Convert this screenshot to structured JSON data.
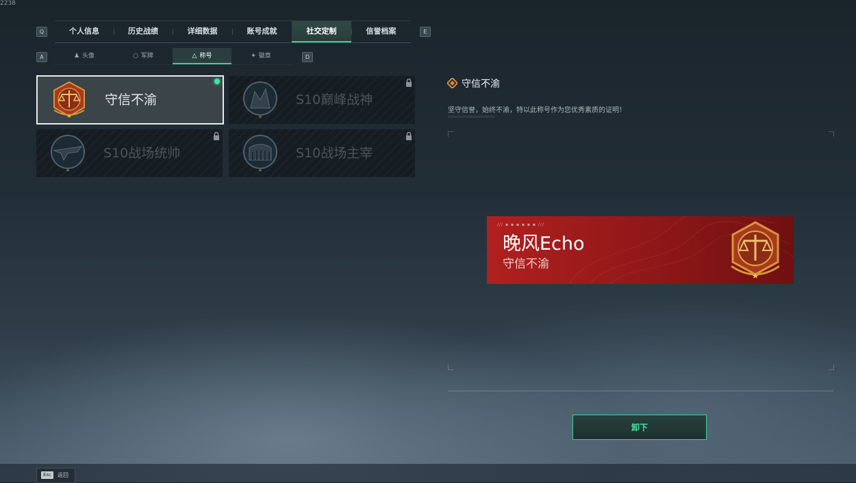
{
  "build_no": "2238",
  "top_nav": {
    "left_key": "Q",
    "right_key": "E",
    "tabs": [
      {
        "label": "个人信息",
        "active": false
      },
      {
        "label": "历史战绩",
        "active": false
      },
      {
        "label": "详细数据",
        "active": false
      },
      {
        "label": "账号成就",
        "active": false
      },
      {
        "label": "社交定制",
        "active": true
      },
      {
        "label": "信誉档案",
        "active": false
      }
    ]
  },
  "sub_nav": {
    "left_key": "A",
    "right_key": "D",
    "tabs": [
      {
        "label": "头像",
        "icon": "person-icon",
        "active": false
      },
      {
        "label": "军牌",
        "icon": "badge-icon",
        "active": false
      },
      {
        "label": "称号",
        "icon": "triangle-icon",
        "active": true
      },
      {
        "label": "徽章",
        "icon": "emblem-icon",
        "active": false
      }
    ]
  },
  "titles": [
    {
      "name": "守信不渝",
      "emblem": "scales-emblem-icon",
      "selected": true,
      "equipped": true,
      "locked": false
    },
    {
      "name": "S10巅峰战神",
      "emblem": "peak-emblem-icon",
      "selected": false,
      "equipped": false,
      "locked": true
    },
    {
      "name": "S10战场统帅",
      "emblem": "aircraft-emblem-icon",
      "selected": false,
      "equipped": false,
      "locked": true
    },
    {
      "name": "S10战场主宰",
      "emblem": "colosseum-emblem-icon",
      "selected": false,
      "equipped": false,
      "locked": true
    }
  ],
  "detail": {
    "icon": "diamond-icon",
    "title": "守信不渝",
    "description": "坚守信誉，始终不渝，特以此称号作为您优秀素质的证明！"
  },
  "nameplate": {
    "player_name": "晚风Echo",
    "title": "守信不渝",
    "emblem": "scales-emblem-icon",
    "colors": {
      "bg": "#a51d1d",
      "emblem_gold": "#d8953a"
    }
  },
  "action_button": {
    "label": "卸下"
  },
  "footer": {
    "key": "Esc",
    "label": "返回"
  },
  "colors": {
    "accent": "#35d39a"
  }
}
